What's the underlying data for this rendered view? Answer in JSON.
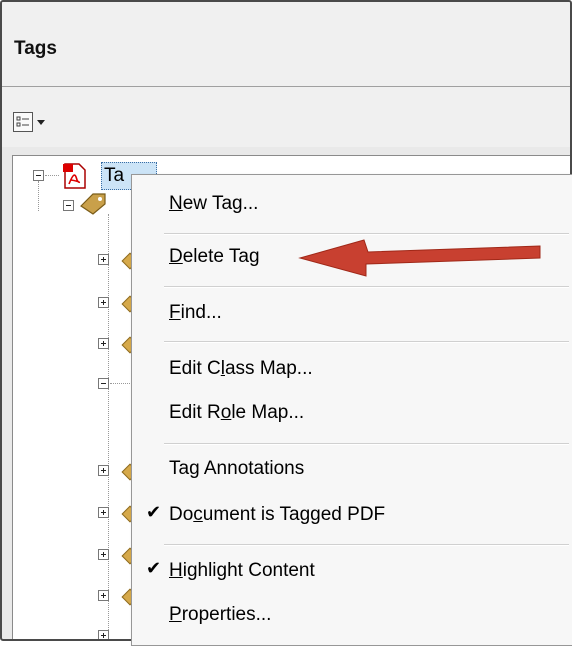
{
  "panel": {
    "title": "Tags"
  },
  "toolbar": {
    "options_icon": "options-icon",
    "dropdown_icon": "chevron-down-icon"
  },
  "tree": {
    "root_label": "Ta",
    "root_icon": "pdf-document-icon",
    "tag_icon": "tag-icon"
  },
  "menu": {
    "items": [
      {
        "pre": "",
        "key": "N",
        "post": "ew Tag...",
        "checked": false
      },
      {
        "pre": "",
        "key": "D",
        "post": "elete Tag",
        "checked": false
      },
      {
        "pre": "",
        "key": "F",
        "post": "ind...",
        "checked": false
      },
      {
        "pre": "Edit C",
        "key": "l",
        "post": "ass Map...",
        "checked": false
      },
      {
        "pre": "Edit R",
        "key": "o",
        "post": "le Map...",
        "checked": false
      },
      {
        "pre": "Ta",
        "key": "g",
        "post": " Annotations",
        "checked": false
      },
      {
        "pre": "Do",
        "key": "c",
        "post": "ument is Tagged PDF",
        "checked": true
      },
      {
        "pre": "",
        "key": "H",
        "post": "ighlight Content",
        "checked": true
      },
      {
        "pre": "",
        "key": "P",
        "post": "roperties...",
        "checked": false
      }
    ],
    "check_glyph": "✔"
  },
  "annotation": {
    "arrow_color": "#c0392b",
    "points_to": "Delete Tag"
  }
}
